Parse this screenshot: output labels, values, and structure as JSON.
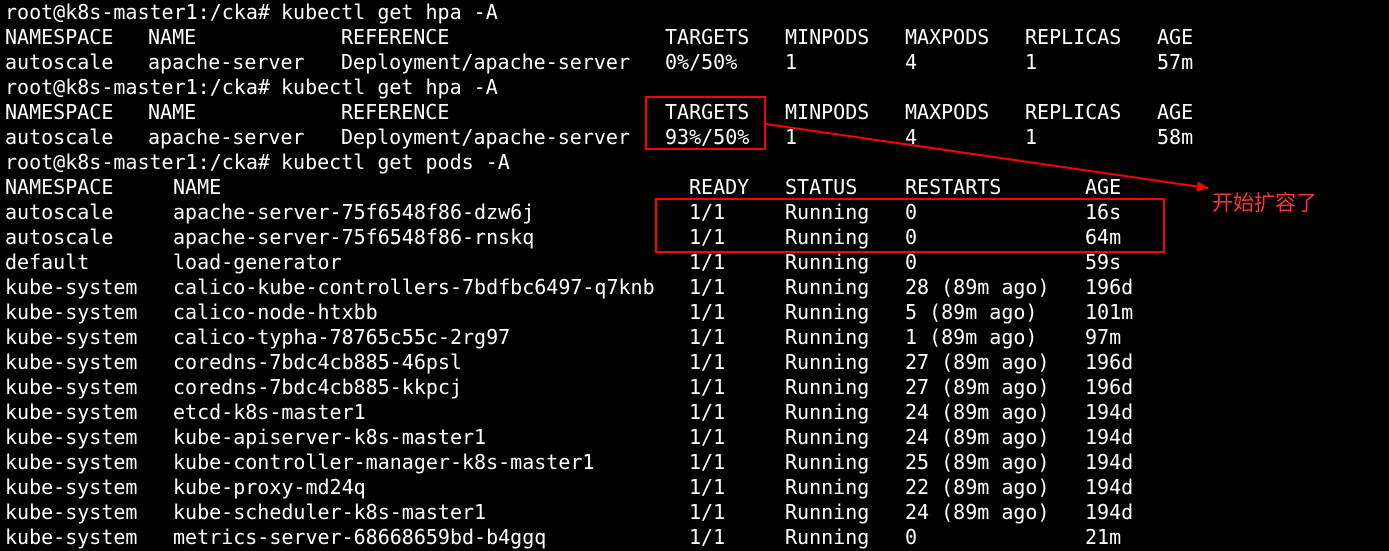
{
  "colors": {
    "background": "#000000",
    "text": "#ffffff",
    "annotation": "#ff0000"
  },
  "lines": [
    {
      "kind": "prompt",
      "prompt": "root@k8s-master1:/cka#",
      "command": "kubectl get hpa -A"
    },
    {
      "kind": "hpa-header",
      "cells": [
        "NAMESPACE",
        "NAME",
        "REFERENCE",
        "TARGETS",
        "MINPODS",
        "MAXPODS",
        "REPLICAS",
        "AGE"
      ]
    },
    {
      "kind": "hpa-row",
      "cells": [
        "autoscale",
        "apache-server",
        "Deployment/apache-server",
        "0%/50%",
        "1",
        "4",
        "1",
        "57m"
      ]
    },
    {
      "kind": "prompt",
      "prompt": "root@k8s-master1:/cka#",
      "command": "kubectl get hpa -A"
    },
    {
      "kind": "hpa-header",
      "cells": [
        "NAMESPACE",
        "NAME",
        "REFERENCE",
        "TARGETS",
        "MINPODS",
        "MAXPODS",
        "REPLICAS",
        "AGE"
      ]
    },
    {
      "kind": "hpa-row",
      "cells": [
        "autoscale",
        "apache-server",
        "Deployment/apache-server",
        "93%/50%",
        "1",
        "4",
        "1",
        "58m"
      ]
    },
    {
      "kind": "prompt",
      "prompt": "root@k8s-master1:/cka#",
      "command": "kubectl get pods -A"
    },
    {
      "kind": "pods-header",
      "cells": [
        "NAMESPACE",
        "NAME",
        "READY",
        "STATUS",
        "RESTARTS",
        "AGE"
      ]
    },
    {
      "kind": "pods-row",
      "cells": [
        "autoscale",
        "apache-server-75f6548f86-dzw6j",
        "1/1",
        "Running",
        "0",
        "16s"
      ]
    },
    {
      "kind": "pods-row",
      "cells": [
        "autoscale",
        "apache-server-75f6548f86-rnskq",
        "1/1",
        "Running",
        "0",
        "64m"
      ]
    },
    {
      "kind": "pods-row",
      "cells": [
        "default",
        "load-generator",
        "1/1",
        "Running",
        "0",
        "59s"
      ]
    },
    {
      "kind": "pods-row",
      "cells": [
        "kube-system",
        "calico-kube-controllers-7bdfbc6497-q7knb",
        "1/1",
        "Running",
        "28 (89m ago)",
        "196d"
      ]
    },
    {
      "kind": "pods-row",
      "cells": [
        "kube-system",
        "calico-node-htxbb",
        "1/1",
        "Running",
        "5 (89m ago)",
        "101m"
      ]
    },
    {
      "kind": "pods-row",
      "cells": [
        "kube-system",
        "calico-typha-78765c55c-2rg97",
        "1/1",
        "Running",
        "1 (89m ago)",
        "97m"
      ]
    },
    {
      "kind": "pods-row",
      "cells": [
        "kube-system",
        "coredns-7bdc4cb885-46psl",
        "1/1",
        "Running",
        "27 (89m ago)",
        "196d"
      ]
    },
    {
      "kind": "pods-row",
      "cells": [
        "kube-system",
        "coredns-7bdc4cb885-kkpcj",
        "1/1",
        "Running",
        "27 (89m ago)",
        "196d"
      ]
    },
    {
      "kind": "pods-row",
      "cells": [
        "kube-system",
        "etcd-k8s-master1",
        "1/1",
        "Running",
        "24 (89m ago)",
        "194d"
      ]
    },
    {
      "kind": "pods-row",
      "cells": [
        "kube-system",
        "kube-apiserver-k8s-master1",
        "1/1",
        "Running",
        "24 (89m ago)",
        "194d"
      ]
    },
    {
      "kind": "pods-row",
      "cells": [
        "kube-system",
        "kube-controller-manager-k8s-master1",
        "1/1",
        "Running",
        "25 (89m ago)",
        "194d"
      ]
    },
    {
      "kind": "pods-row",
      "cells": [
        "kube-system",
        "kube-proxy-md24q",
        "1/1",
        "Running",
        "22 (89m ago)",
        "194d"
      ]
    },
    {
      "kind": "pods-row",
      "cells": [
        "kube-system",
        "kube-scheduler-k8s-master1",
        "1/1",
        "Running",
        "24 (89m ago)",
        "194d"
      ]
    },
    {
      "kind": "pods-row",
      "cells": [
        "kube-system",
        "metrics-server-68668659bd-b4ggq",
        "1/1",
        "Running",
        "0",
        "21m"
      ]
    }
  ],
  "annotation": {
    "text": "开始扩容了"
  }
}
